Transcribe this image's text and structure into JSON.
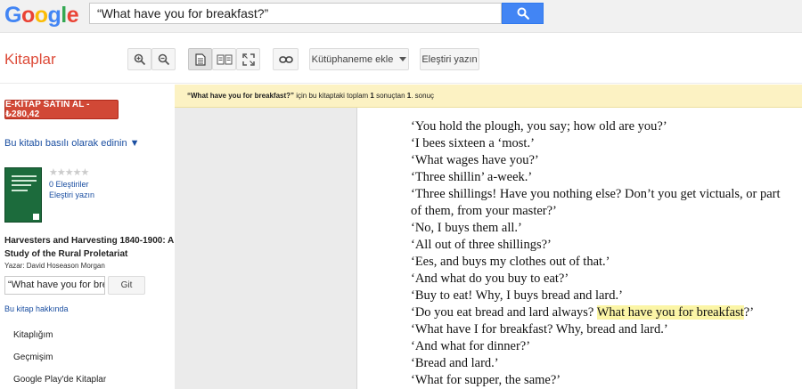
{
  "google": {
    "logo_letters": [
      {
        "ch": "G",
        "color": "#4285F4"
      },
      {
        "ch": "o",
        "color": "#EA4335"
      },
      {
        "ch": "o",
        "color": "#FBBC05"
      },
      {
        "ch": "g",
        "color": "#4285F4"
      },
      {
        "ch": "l",
        "color": "#34A853"
      },
      {
        "ch": "e",
        "color": "#EA4335"
      }
    ],
    "search_value": "“What have you for breakfast?”",
    "search_icon": "magnifier-icon"
  },
  "toolbar": {
    "brand": "Kitaplar",
    "zoom_in_icon": "zoom-in-icon",
    "zoom_out_icon": "zoom-out-icon",
    "single_page_icon": "single-page-icon",
    "two_page_icon": "two-page-icon",
    "fullscreen_icon": "fullscreen-icon",
    "link_icon": "link-icon",
    "library_label": "Kütüphaneme ekle",
    "review_label": "Eleştiri yazın"
  },
  "sidebar": {
    "buy_label": "E-KİTAP SATIN AL - ₺280,42",
    "get_print_label": "Bu kitabı basılı olarak edinin ▼",
    "stars": "★★★★★",
    "review_count": "0 Eleştiriler",
    "write_review": "Eleştiri yazın",
    "book_title": "Harvesters and Harvesting 1840-1900: A Study of the Rural Proletariat",
    "author_line": "Yazar: David Hoseason Morgan",
    "inbook_search_value": "“What have you for brea",
    "go_label": "Git",
    "about_label": "Bu kitap hakkında",
    "nav": [
      "Kitaplığım",
      "Geçmişim",
      "Google Play'de Kitaplar"
    ]
  },
  "notice": {
    "query": "“What have you for breakfast?”",
    "mid": " için bu kitaptaki toplam ",
    "total": "1",
    "mid2": " sonuçtan ",
    "index": "1",
    "end": ". sonuç"
  },
  "page": {
    "lines": [
      "‘You hold the plough, you say; how old are you?’",
      "‘I bees sixteen a ‘most.’",
      "‘What wages have you?’",
      "‘Three shillin’ a-week.’",
      "‘Three shillings! Have you nothing else? Don’t you get victuals, or part",
      "of them, from your master?’",
      "‘No, I buys them all.’",
      "‘All out of three shillings?’",
      "‘Ees, and buys my clothes out of that.’",
      "‘And what do you buy to eat?’",
      "‘Buy to eat! Why, I buys bread and lard.’",
      "__HL__",
      "‘What have I for breakfast? Why, bread and lard.’",
      "‘And what for dinner?’",
      "‘Bread and lard.’",
      "‘What for supper, the same?’"
    ],
    "hl_before": "‘Do you eat bread and lard always? ",
    "hl_text": "What have you for breakfast",
    "hl_after": "?’"
  },
  "colors": {
    "accent_red": "#d14836",
    "search_blue": "#4285f4",
    "link_blue": "#1a4ea1",
    "highlight": "#fbf5a6",
    "notice_bg": "#fcf2c3"
  }
}
